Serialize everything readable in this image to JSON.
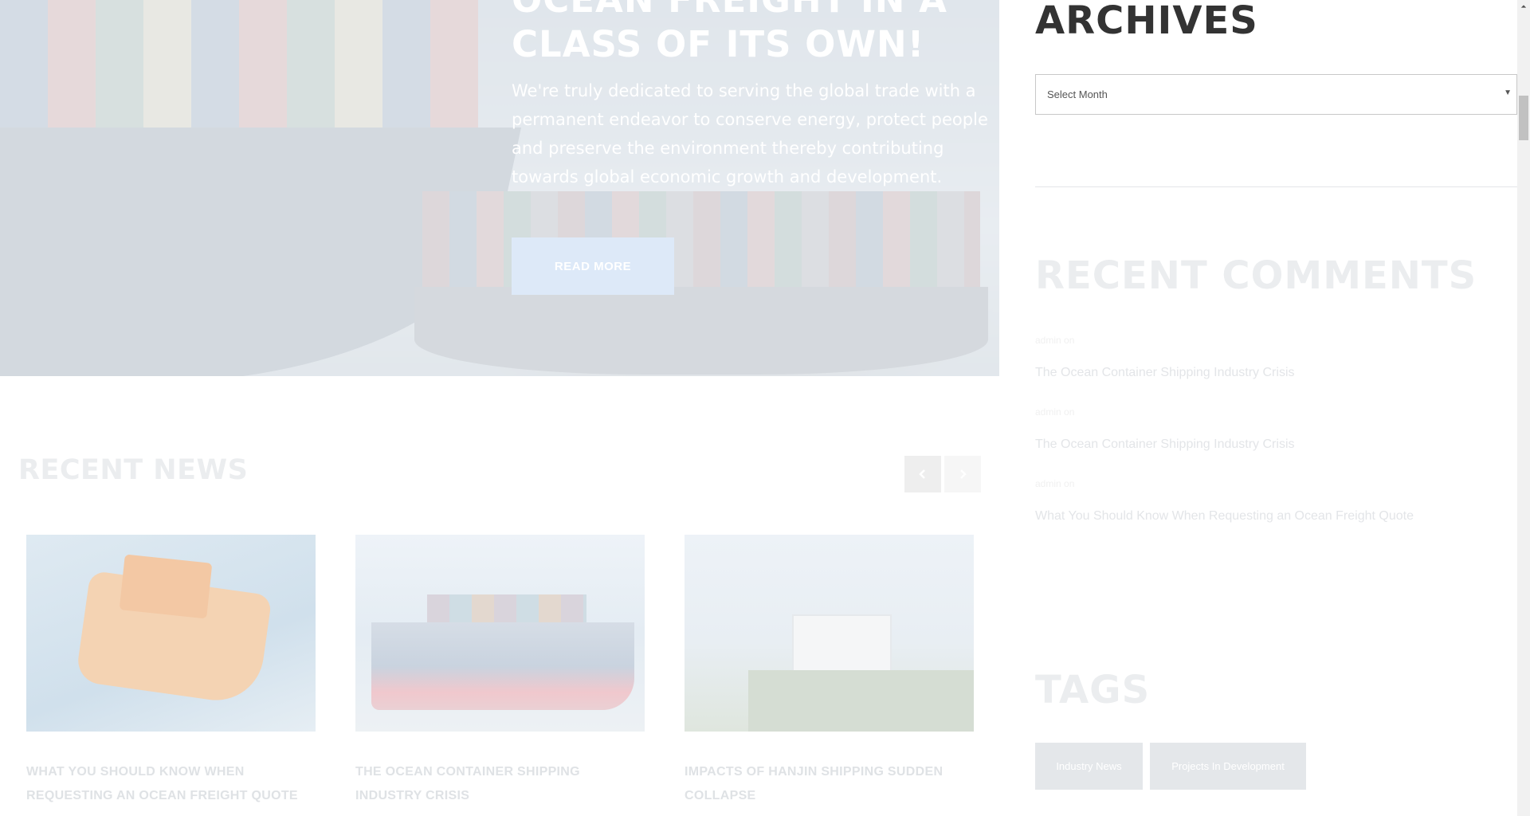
{
  "hero": {
    "title": "OCEAN FREIGHT IN A CLASS OF ITS OWN!",
    "text": "We're truly dedicated to serving the global trade with a permanent endeavor to conserve energy, protect people and preserve the environment thereby contributing towards global economic growth and development.",
    "button_label": "READ MORE"
  },
  "news": {
    "title": "RECENT NEWS",
    "prev_icon": "chevron-left-icon",
    "next_icon": "chevron-right-icon",
    "cards": [
      {
        "title": "WHAT YOU SHOULD KNOW WHEN REQUESTING AN OCEAN FREIGHT QUOTE"
      },
      {
        "title": "THE OCEAN CONTAINER SHIPPING INDUSTRY CRISIS"
      },
      {
        "title": "IMPACTS OF HANJIN SHIPPING SUDDEN COLLAPSE"
      }
    ]
  },
  "sidebar": {
    "archives": {
      "title": "ARCHIVES",
      "select_value": "Select Month"
    },
    "recent_comments": {
      "title": "RECENT COMMENTS",
      "items": [
        {
          "meta": "admin on",
          "link": "The Ocean Container Shipping Industry Crisis"
        },
        {
          "meta": "admin on",
          "link": "The Ocean Container Shipping Industry Crisis"
        },
        {
          "meta": "admin on",
          "link": "What You Should Know When Requesting an Ocean Freight Quote"
        }
      ]
    },
    "tags": {
      "title": "TAGS",
      "items": [
        "Industry News",
        "Projects In Development"
      ]
    }
  },
  "colors": {
    "accent_button": "#dde9f8",
    "heading_dark": "#333333",
    "faded_text": "#ebedef"
  }
}
